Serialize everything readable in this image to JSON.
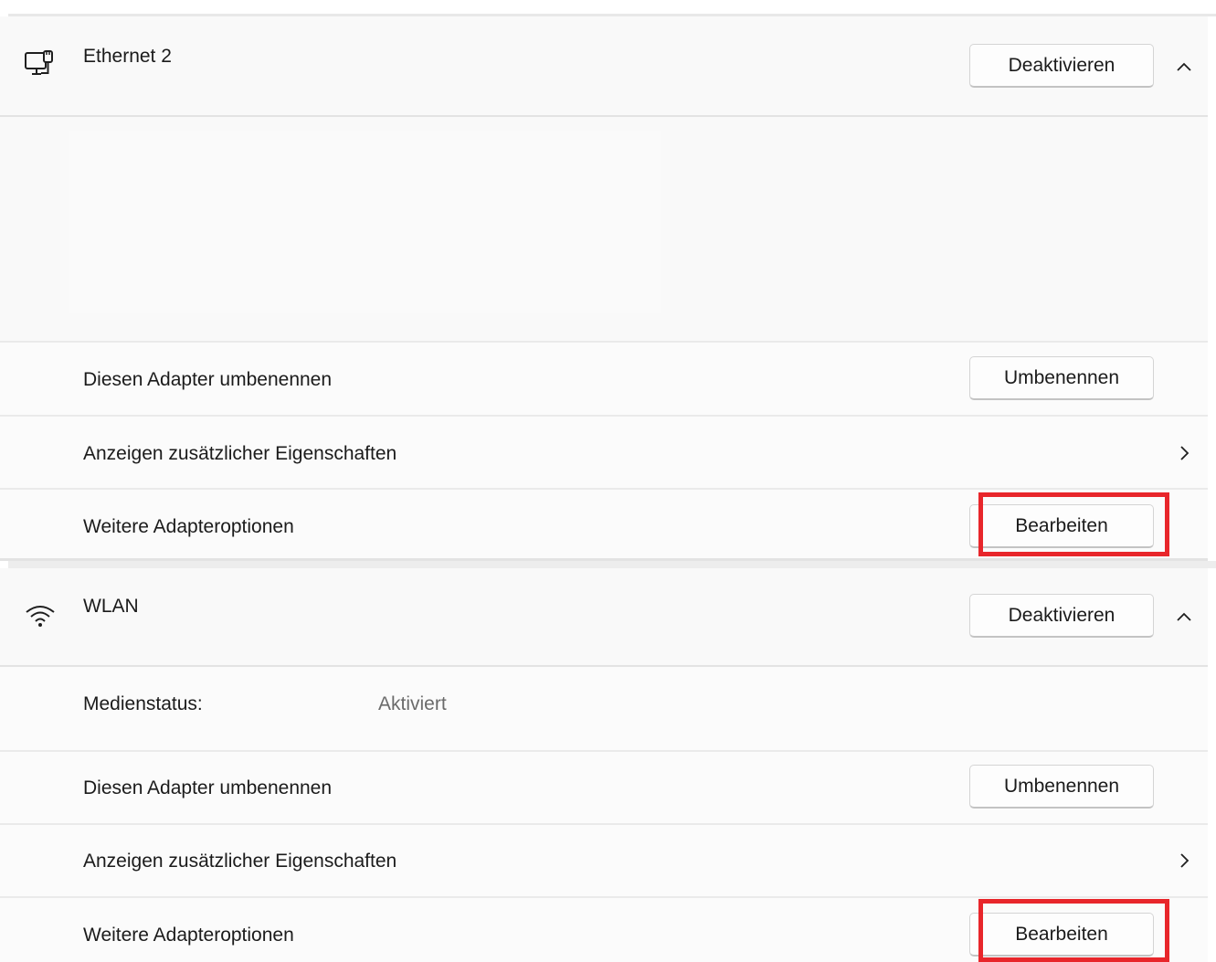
{
  "ethernet": {
    "title": "Ethernet 2",
    "deactivate_label": "Deaktivieren",
    "icon": "ethernet-monitor-icon",
    "rows": {
      "rename_label": "Diesen Adapter umbenennen",
      "rename_button": "Umbenennen",
      "properties_label": "Anzeigen zusätzlicher Eigenschaften",
      "more_options_label": "Weitere Adapteroptionen",
      "edit_button": "Bearbeiten"
    }
  },
  "wlan": {
    "title": "WLAN",
    "deactivate_label": "Deaktivieren",
    "icon": "wifi-icon",
    "media_status_label": "Medienstatus:",
    "media_status_value": "Aktiviert",
    "rows": {
      "rename_label": "Diesen Adapter umbenennen",
      "rename_button": "Umbenennen",
      "properties_label": "Anzeigen zusätzlicher Eigenschaften",
      "more_options_label": "Weitere Adapteroptionen",
      "edit_button": "Bearbeiten"
    }
  },
  "colors": {
    "highlight": "#e8262b",
    "panel": "#f9f9f9",
    "divider": "#eaeaea"
  }
}
